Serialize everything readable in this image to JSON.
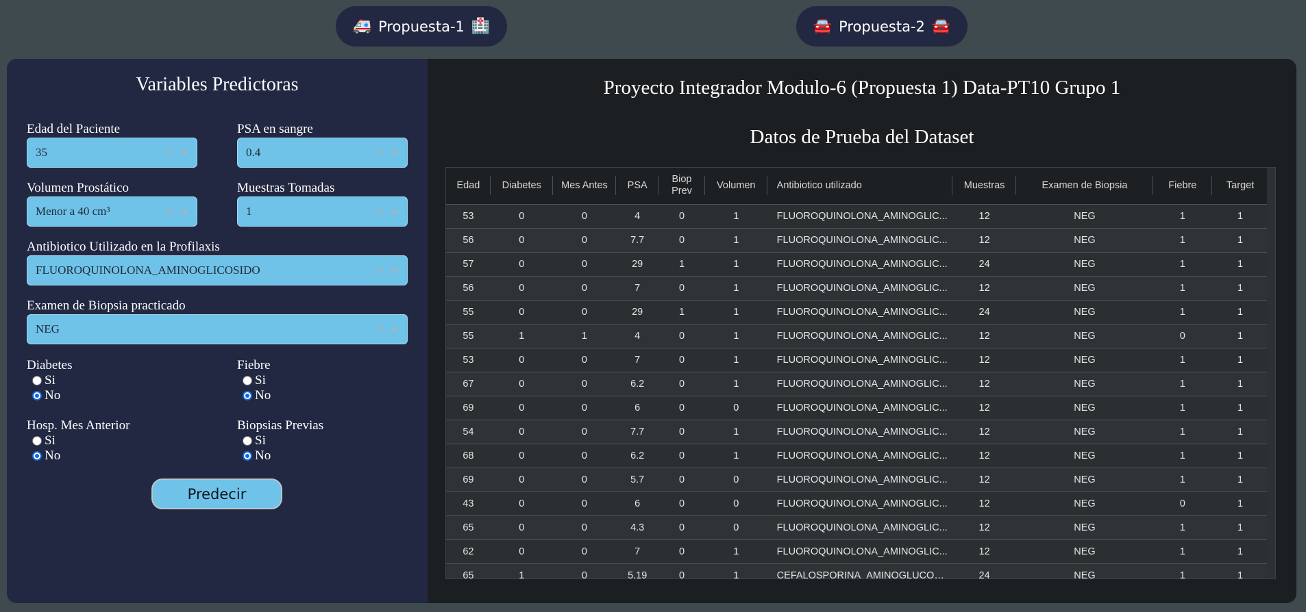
{
  "tabs": [
    {
      "label": "Propuesta-1",
      "icon_left": "ambulance-icon",
      "icon_right": "hospital-icon",
      "glyph_left": "🚑",
      "glyph_right": "🏥"
    },
    {
      "label": "Propuesta-2",
      "icon_left": "car-icon",
      "icon_right": "car-icon",
      "glyph_left": "🚘",
      "glyph_right": "🚘"
    }
  ],
  "left": {
    "title": "Variables Predictoras",
    "edad": {
      "label": "Edad del Paciente",
      "value": "35"
    },
    "psa": {
      "label": "PSA en sangre",
      "value": "0.4"
    },
    "volumen": {
      "label": "Volumen Prostático",
      "value": "Menor a 40 cm³"
    },
    "muestras": {
      "label": "Muestras Tomadas",
      "value": "1"
    },
    "antibiotico": {
      "label": "Antibiotico Utilizado en la Profilaxis",
      "value": "FLUOROQUINOLONA_AMINOGLICOSIDO"
    },
    "biopsia": {
      "label": "Examen de Biopsia practicado",
      "value": "NEG"
    },
    "diabetes": {
      "label": "Diabetes",
      "options": [
        "Si",
        "No"
      ],
      "selected": "No"
    },
    "fiebre": {
      "label": "Fiebre",
      "options": [
        "Si",
        "No"
      ],
      "selected": "No"
    },
    "hosp": {
      "label": "Hosp. Mes Anterior",
      "options": [
        "Si",
        "No"
      ],
      "selected": "No"
    },
    "biopsias_previas": {
      "label": "Biopsias Previas",
      "options": [
        "Si",
        "No"
      ],
      "selected": "No"
    },
    "predict_label": "Predecir"
  },
  "right": {
    "title": "Proyecto Integrador Modulo-6 (Propuesta 1) Data-PT10 Grupo 1",
    "subtitle": "Datos de Prueba del Dataset",
    "columns": [
      "Edad",
      "Diabetes",
      "Mes Antes",
      "PSA",
      "Biop Prev",
      "Volumen",
      "Antibiotico utilizado",
      "Muestras",
      "Examen de Biopsia",
      "Fiebre",
      "Target"
    ],
    "rows": [
      [
        "53",
        "0",
        "0",
        "4",
        "0",
        "1",
        "FLUOROQUINOLONA_AMINOGLIC...",
        "12",
        "NEG",
        "1",
        "1"
      ],
      [
        "56",
        "0",
        "0",
        "7.7",
        "0",
        "1",
        "FLUOROQUINOLONA_AMINOGLIC...",
        "12",
        "NEG",
        "1",
        "1"
      ],
      [
        "57",
        "0",
        "0",
        "29",
        "1",
        "1",
        "FLUOROQUINOLONA_AMINOGLIC...",
        "24",
        "NEG",
        "1",
        "1"
      ],
      [
        "56",
        "0",
        "0",
        "7",
        "0",
        "1",
        "FLUOROQUINOLONA_AMINOGLIC...",
        "12",
        "NEG",
        "1",
        "1"
      ],
      [
        "55",
        "0",
        "0",
        "29",
        "1",
        "1",
        "FLUOROQUINOLONA_AMINOGLIC...",
        "24",
        "NEG",
        "1",
        "1"
      ],
      [
        "55",
        "1",
        "1",
        "4",
        "0",
        "1",
        "FLUOROQUINOLONA_AMINOGLIC...",
        "12",
        "NEG",
        "0",
        "1"
      ],
      [
        "53",
        "0",
        "0",
        "7",
        "0",
        "1",
        "FLUOROQUINOLONA_AMINOGLIC...",
        "12",
        "NEG",
        "1",
        "1"
      ],
      [
        "67",
        "0",
        "0",
        "6.2",
        "0",
        "1",
        "FLUOROQUINOLONA_AMINOGLIC...",
        "12",
        "NEG",
        "1",
        "1"
      ],
      [
        "69",
        "0",
        "0",
        "6",
        "0",
        "0",
        "FLUOROQUINOLONA_AMINOGLIC...",
        "12",
        "NEG",
        "1",
        "1"
      ],
      [
        "54",
        "0",
        "0",
        "7.7",
        "0",
        "1",
        "FLUOROQUINOLONA_AMINOGLIC...",
        "12",
        "NEG",
        "1",
        "1"
      ],
      [
        "68",
        "0",
        "0",
        "6.2",
        "0",
        "1",
        "FLUOROQUINOLONA_AMINOGLIC...",
        "12",
        "NEG",
        "1",
        "1"
      ],
      [
        "69",
        "0",
        "0",
        "5.7",
        "0",
        "0",
        "FLUOROQUINOLONA_AMINOGLIC...",
        "12",
        "NEG",
        "1",
        "1"
      ],
      [
        "43",
        "0",
        "0",
        "6",
        "0",
        "0",
        "FLUOROQUINOLONA_AMINOGLIC...",
        "12",
        "NEG",
        "0",
        "1"
      ],
      [
        "65",
        "0",
        "0",
        "4.3",
        "0",
        "0",
        "FLUOROQUINOLONA_AMINOGLIC...",
        "12",
        "NEG",
        "1",
        "1"
      ],
      [
        "62",
        "0",
        "0",
        "7",
        "0",
        "1",
        "FLUOROQUINOLONA_AMINOGLIC...",
        "12",
        "NEG",
        "1",
        "1"
      ],
      [
        "65",
        "1",
        "0",
        "5.19",
        "0",
        "1",
        "CEFALOSPORINA_AMINOGLUCOCI...",
        "24",
        "NEG",
        "1",
        "1"
      ]
    ]
  }
}
